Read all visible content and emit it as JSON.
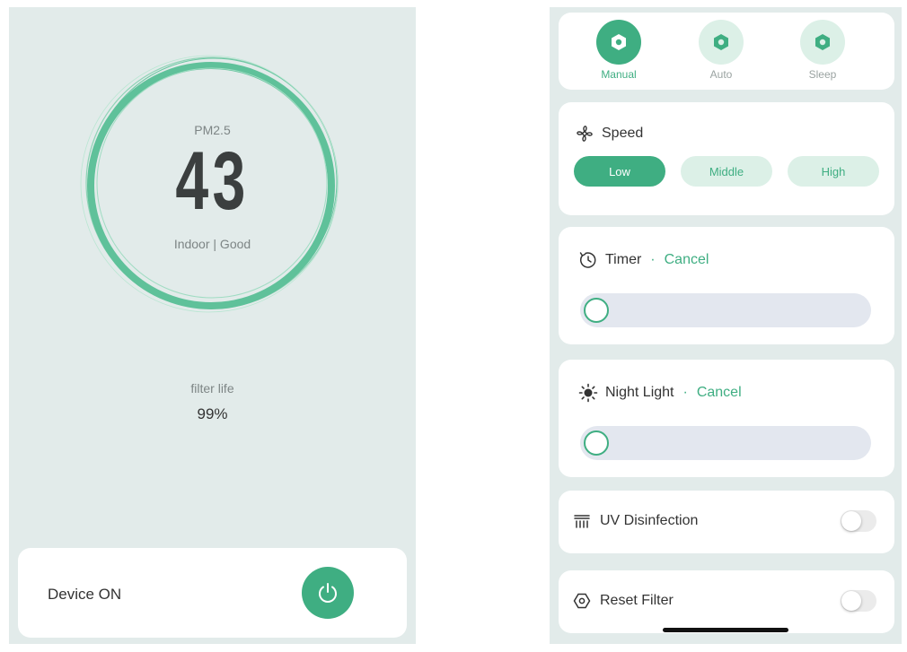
{
  "left": {
    "pm_label": "PM2.5",
    "pm_value": "43",
    "indoor_status": "Indoor | Good",
    "filter_label": "filter life",
    "filter_value": "99%",
    "device_label": "Device ON",
    "power_icon": "power-icon"
  },
  "right": {
    "modes": [
      {
        "label": "Manual",
        "icon": "hexagon-nut-icon",
        "active": true
      },
      {
        "label": "Auto",
        "icon": "hexagon-nut-icon",
        "active": false
      },
      {
        "label": "Sleep",
        "icon": "hexagon-nut-icon",
        "active": false
      }
    ],
    "speed": {
      "title": "Speed",
      "icon": "fan-icon",
      "options": [
        "Low",
        "Middle",
        "High"
      ],
      "selected": "Low"
    },
    "timer": {
      "title": "Timer",
      "separator": "·",
      "cancel": "Cancel",
      "icon": "clock-icon",
      "value": 0
    },
    "night_light": {
      "title": "Night Light",
      "separator": "·",
      "cancel": "Cancel",
      "icon": "sun-icon",
      "value": 0
    },
    "uv": {
      "label": "UV Disinfection",
      "icon": "uv-lamp-icon",
      "on": false
    },
    "reset_filter": {
      "label": "Reset Filter",
      "icon": "hexagon-icon",
      "on": false
    }
  },
  "colors": {
    "accent": "#3fae82",
    "accent_light": "#dcf0e7",
    "panel_bg": "#e2ebea",
    "slider_track": "#e3e7ef"
  }
}
